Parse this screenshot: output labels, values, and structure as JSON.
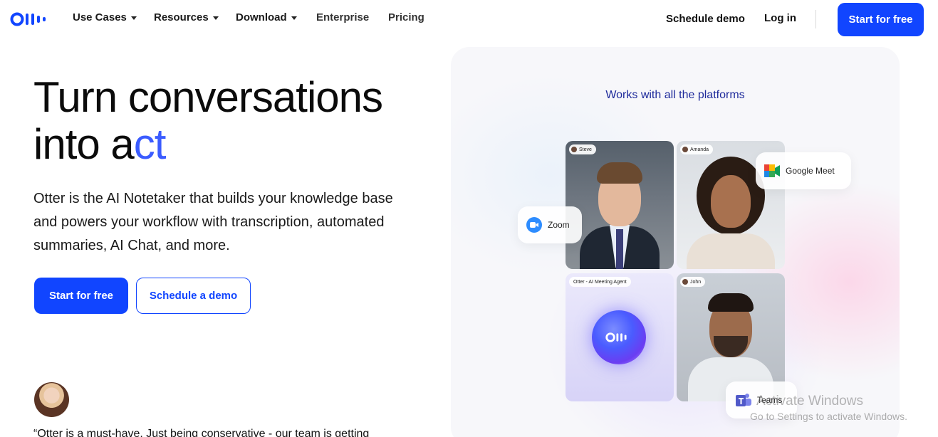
{
  "brand": {
    "logo_alt": "Otter.ai",
    "color": "#1145ff"
  },
  "nav": {
    "items": [
      {
        "label": "Use Cases",
        "dropdown": true
      },
      {
        "label": "Resources",
        "dropdown": true
      },
      {
        "label": "Download",
        "dropdown": true
      },
      {
        "label": "Enterprise",
        "dropdown": false
      },
      {
        "label": "Pricing",
        "dropdown": false
      }
    ],
    "schedule_demo": "Schedule demo",
    "login": "Log in",
    "cta": "Start for free"
  },
  "hero": {
    "title_line1": "Turn conversations",
    "title_line2_prefix": "into a",
    "title_line2_highlight": "ct",
    "description": "Otter is the AI Notetaker that builds your knowledge base and powers your workflow with transcription, automated summaries, AI Chat, and more.",
    "primary_button": "Start for free",
    "secondary_button": "Schedule a demo",
    "quote": "“Otter is a must-have. Just being conservative - our team is getting"
  },
  "showcase": {
    "title": "Works with all the platforms",
    "tiles": [
      {
        "label": "Steve"
      },
      {
        "label": "Amanda"
      },
      {
        "label": "Otter - AI Meeting Agent"
      },
      {
        "label": "John"
      }
    ],
    "platforms": {
      "zoom": "Zoom",
      "meet": "Google Meet",
      "teams": "Teams"
    }
  },
  "watermark": {
    "line1": "Activate Windows",
    "line2": "Go to Settings to activate Windows."
  }
}
